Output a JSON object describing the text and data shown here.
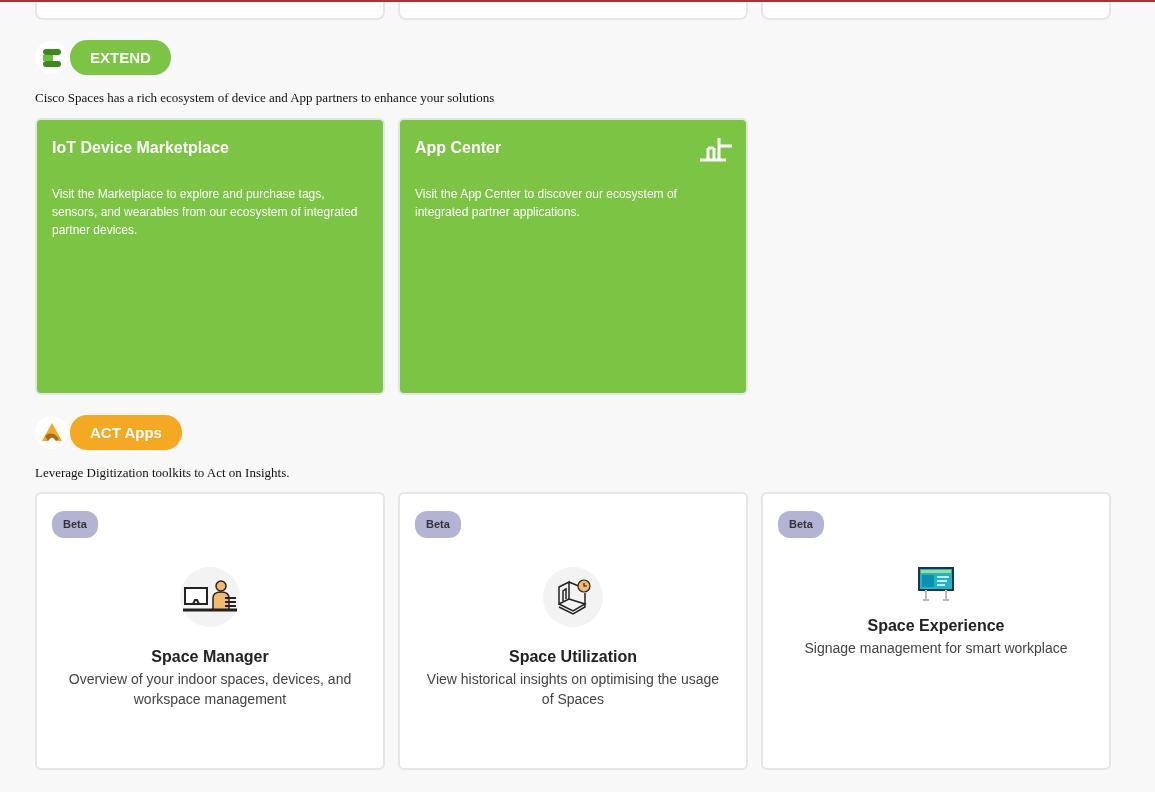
{
  "sections": [
    {
      "kind": "extend",
      "label": "EXTEND",
      "description": "Cisco Spaces has a rich ecosystem of device and App partners to enhance your solutions",
      "cards": [
        {
          "kind": "marketplace",
          "title": "IoT Device Marketplace",
          "text": "Visit the Marketplace to explore and purchase tags, sensors, and wearables from our ecosystem of integrated partner devices."
        },
        {
          "kind": "appcenter",
          "title": "App Center",
          "text": "Visit the App Center to discover our ecosystem of integrated partner applications."
        }
      ]
    },
    {
      "kind": "act",
      "label": "ACT Apps",
      "description": "Leverage Digitization toolkits to Act on Insights.",
      "cards": [
        {
          "kind": "manager",
          "badge": "Beta",
          "title": "Space Manager",
          "text": "Overview of your indoor spaces, devices, and workspace management"
        },
        {
          "kind": "utilization",
          "badge": "Beta",
          "title": "Space Utilization",
          "text": "View historical insights on optimising the usage of Spaces"
        },
        {
          "kind": "signage",
          "badge": "Beta",
          "title": "Space Experience",
          "text": "Signage management for smart workplace"
        }
      ]
    }
  ]
}
